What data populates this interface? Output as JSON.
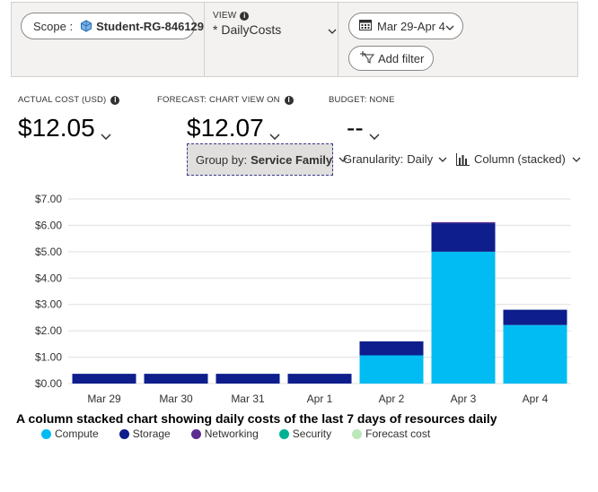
{
  "header": {
    "scope": {
      "label": "Scope :",
      "value": "Student-RG-846129",
      "icon": "resource-group-icon"
    },
    "view": {
      "caption": "VIEW",
      "name": "* DailyCosts"
    },
    "date_range": {
      "value": "Mar 29-Apr 4",
      "icon": "calendar-icon"
    },
    "add_filter": {
      "label": "Add filter",
      "icon": "filter-add-icon"
    }
  },
  "kpis": {
    "actual": {
      "caption": "ACTUAL COST (USD)",
      "value": "$12.05"
    },
    "forecast": {
      "caption": "FORECAST: CHART VIEW ON",
      "value": "$12.07"
    },
    "budget": {
      "caption": "BUDGET: NONE",
      "value": "--"
    }
  },
  "controls": {
    "group_by": {
      "label": "Group by:",
      "value": "Service Family"
    },
    "granularity": {
      "label": "Granularity:",
      "value": "Daily"
    },
    "chart_type": {
      "label": "Column (stacked)",
      "icon": "column-chart-icon"
    }
  },
  "caption": "A column stacked chart showing daily costs of the last 7 days of resources daily",
  "colors": {
    "compute": "#00bcf2",
    "storage": "#0e1e8c",
    "networking": "#5c2d91",
    "security": "#00b294",
    "forecast": "#bce8b9"
  },
  "chart_data": {
    "type": "bar",
    "stacked": true,
    "categories": [
      "Mar 29",
      "Mar 30",
      "Mar 31",
      "Apr 1",
      "Apr 2",
      "Apr 3",
      "Apr 4"
    ],
    "series": [
      {
        "name": "Compute",
        "values": [
          0,
          0,
          0,
          0,
          1.07,
          5.0,
          2.22
        ]
      },
      {
        "name": "Storage",
        "values": [
          0.37,
          0.37,
          0.37,
          0.37,
          0.53,
          1.08,
          0.58
        ]
      },
      {
        "name": "Networking",
        "values": [
          0,
          0,
          0,
          0,
          0,
          0.04,
          0
        ]
      },
      {
        "name": "Security",
        "values": [
          0,
          0,
          0,
          0,
          0,
          0,
          0
        ]
      },
      {
        "name": "Forecast cost",
        "values": [
          0,
          0,
          0,
          0,
          0,
          0,
          0
        ]
      }
    ],
    "ylim": [
      0,
      7
    ],
    "yticks": [
      "$0.00",
      "$1.00",
      "$2.00",
      "$3.00",
      "$4.00",
      "$5.00",
      "$6.00",
      "$7.00"
    ],
    "grid": true,
    "legend_position": "bottom-left"
  }
}
